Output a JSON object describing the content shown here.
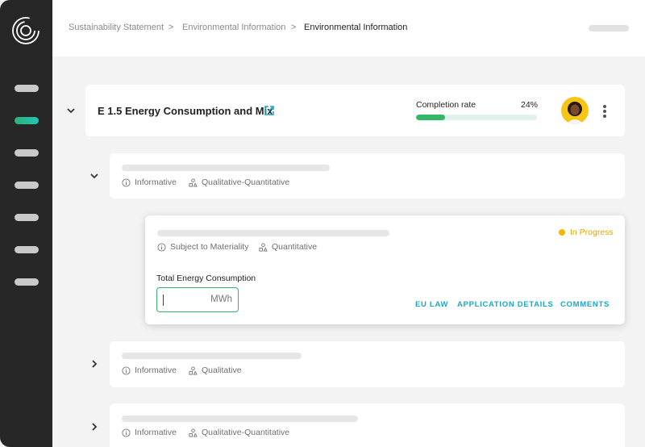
{
  "breadcrumb": {
    "items": [
      "Sustainability Statement",
      "Environmental Information",
      "Environmental Information"
    ],
    "separator": ">"
  },
  "section": {
    "title": "E 1.5 Energy Consumption and Mix",
    "completion_label": "Completion rate",
    "completion_value": "24%",
    "completion_fraction": 0.24
  },
  "rows": [
    {
      "tags": [
        "Informative",
        "Qualitative-Quantitative"
      ]
    },
    {
      "tags": [
        "Subject to Materiality",
        "Quantitative"
      ],
      "status": "In Progress",
      "field_label": "Total Energy Consumption",
      "field_value": "",
      "unit": "MWh",
      "links": [
        "EU LAW",
        "APPLICATION DETAILS",
        "COMMENTS"
      ]
    },
    {
      "tags": [
        "Informative",
        "Qualitative"
      ]
    },
    {
      "tags": [
        "Informative",
        "Qualitative-Quantitative"
      ]
    }
  ],
  "colors": {
    "accent": "#33b86a",
    "link": "#1ba7c4",
    "status": "#f2b807",
    "sidebar": "#272727"
  },
  "icons": [
    "logo-icon",
    "chevron-down-icon",
    "chevron-right-icon",
    "external-link-icon",
    "info-icon",
    "shapes-icon",
    "more-vertical-icon"
  ]
}
